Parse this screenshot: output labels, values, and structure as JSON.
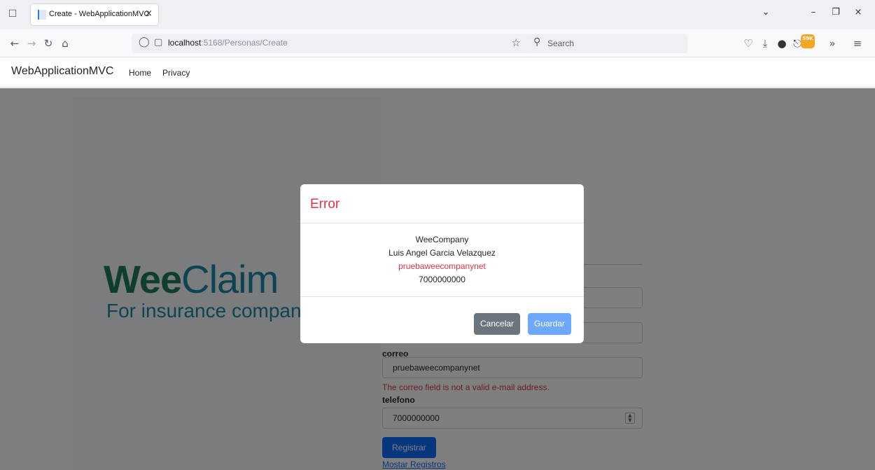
{
  "browser": {
    "tab_title": "Create - WebApplicationMVC",
    "url_host": "localhost",
    "url_path": ":5168/Personas/Create",
    "search_placeholder": "Search",
    "extension_badge": "59K"
  },
  "site": {
    "brand": "WebApplicationMVC",
    "nav": [
      "Home",
      "Privacy"
    ]
  },
  "logo": {
    "wee": "Wee",
    "claim": "Claim",
    "tagline": "For insurance companies"
  },
  "form": {
    "correo_label": "correo",
    "correo_value": "pruebaweecompanynet",
    "correo_error": "The correo field is not a valid e-mail address.",
    "telefono_label": "telefono",
    "telefono_value": "7000000000",
    "submit_label": "Registrar",
    "list_link": "Mostar Registros"
  },
  "modal": {
    "title": "Error",
    "lines": [
      "WeeCompany",
      "Luis Angel Garcia Velazquez",
      "pruebaweecompanynet",
      "7000000000"
    ],
    "cancel_label": "Cancelar",
    "save_label": "Guardar"
  },
  "colors": {
    "error": "#dc3545",
    "primary": "#0d6efd",
    "secondary": "#6c757d",
    "disabled_primary": "#6ea8fe"
  }
}
